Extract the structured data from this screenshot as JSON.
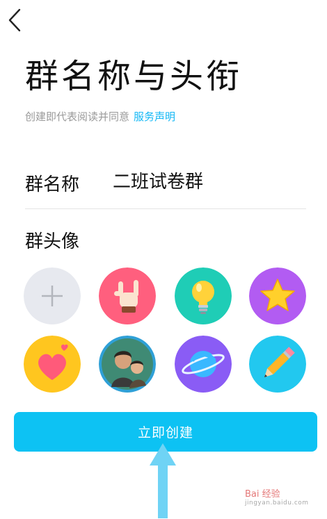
{
  "header": {
    "back_icon": "chevron-left-icon"
  },
  "title": "群名称与头衔",
  "consent": {
    "text": "创建即代表阅读并同意",
    "link": "服务声明"
  },
  "group_name": {
    "label": "群名称",
    "value": "二班试卷群"
  },
  "avatar_section": {
    "label": "群头像",
    "options": [
      {
        "icon": "plus-icon",
        "bg": "#e7e9ef"
      },
      {
        "icon": "hand-gesture-icon",
        "bg": "#ff5f7e"
      },
      {
        "icon": "lightbulb-icon",
        "bg": "#1fcdb6"
      },
      {
        "icon": "star-icon",
        "bg": "#b25cf2"
      },
      {
        "icon": "heart-icon",
        "bg": "#ffc61f"
      },
      {
        "icon": "people-photo-icon",
        "bg": "#2fa0d7"
      },
      {
        "icon": "planet-icon",
        "bg": "#8a5cf5"
      },
      {
        "icon": "pencil-icon",
        "bg": "#22c8ef"
      }
    ]
  },
  "create_button": {
    "label": "立即创建",
    "color": "#0dc2f3"
  },
  "annotation": {
    "icon": "up-arrow-icon",
    "color": "#6fd3f5"
  },
  "watermark": {
    "text": "Bai 经验",
    "sub": "jingyan.baidu.com"
  }
}
